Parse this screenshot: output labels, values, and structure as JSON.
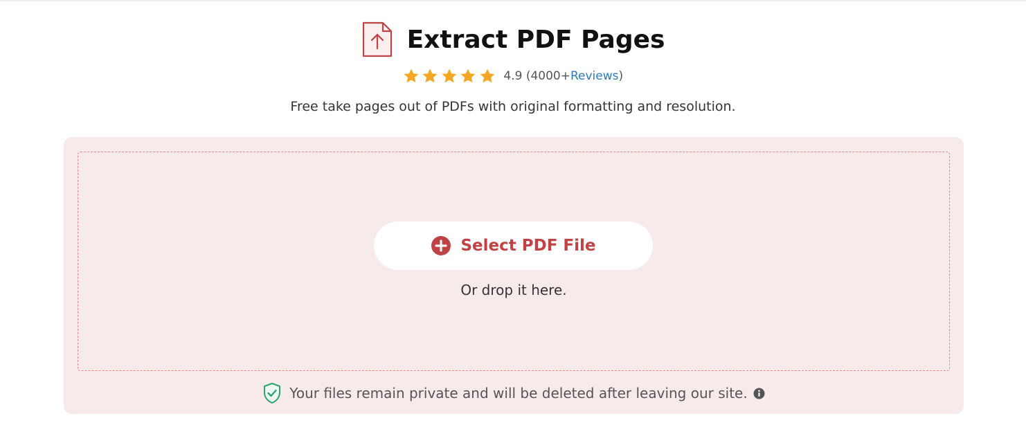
{
  "header": {
    "title": "Extract PDF Pages",
    "icon": "pdf-upload-icon"
  },
  "rating": {
    "score": "4.9",
    "stars": 5,
    "count_prefix": "(4000+ ",
    "reviews_link": "Reviews",
    "count_suffix": ")",
    "star_color": "#f5a623"
  },
  "subtitle": "Free take pages out of PDFs with original formatting and resolution.",
  "upload": {
    "button_label": "Select PDF File",
    "button_icon": "plus-circle-icon",
    "drop_hint": "Or drop it here.",
    "accent_color": "#c04244",
    "panel_color": "#f7eaeb"
  },
  "privacy": {
    "icon": "shield-check-icon",
    "text": "Your files remain private and will be deleted after leaving our site.",
    "info_icon": "info-icon"
  }
}
